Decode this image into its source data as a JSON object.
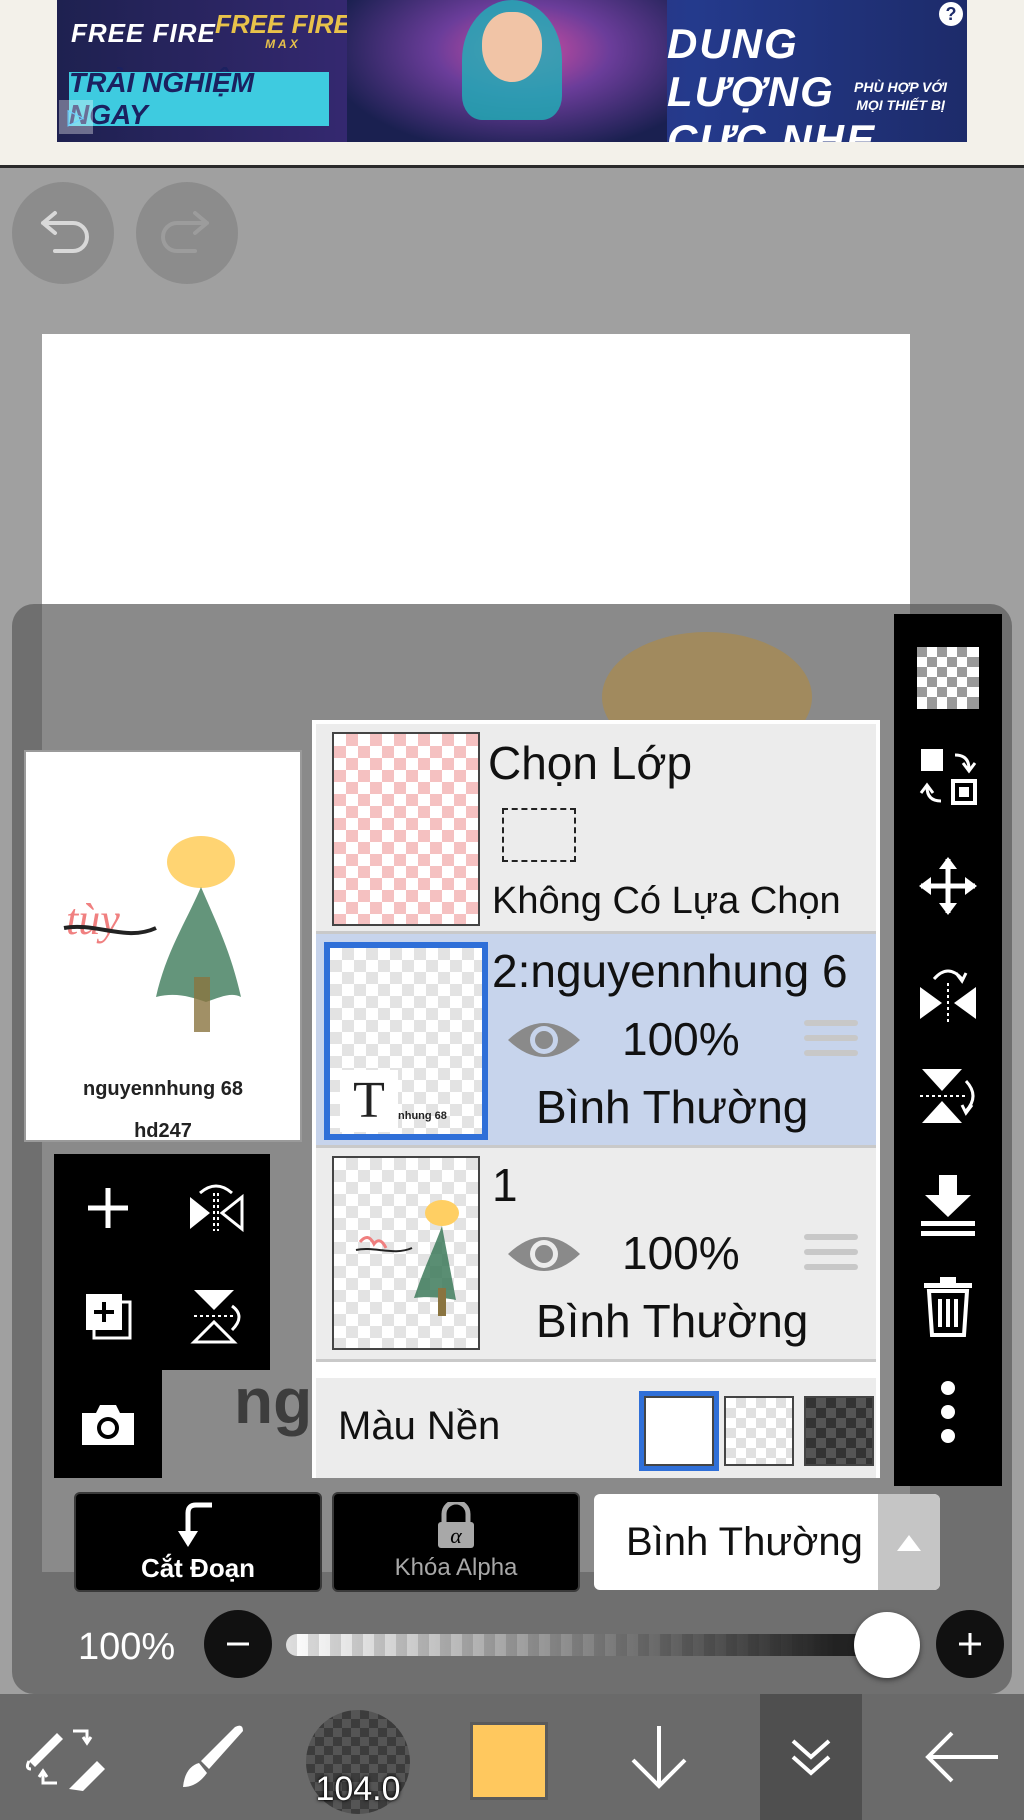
{
  "ad": {
    "brand1": "FREE FIRE",
    "brand2": "FREE FIRE",
    "brand2_sub": "MAX",
    "cta": "TRẢI NGHIỆM NGAY",
    "headline_line1": "DUNG LƯỢNG",
    "headline_line2": "CỰC NHẸ",
    "small_line1": "PHÙ HỢP VỚI",
    "small_line2": "MỌI THIẾT BỊ",
    "help": "?"
  },
  "preview": {
    "caption_line1": "nguyennhung 68",
    "caption_line2": "hd247",
    "doodle_text": "tùy"
  },
  "canvas": {
    "ghost_text": "ng"
  },
  "layers": {
    "selection": {
      "title": "Chọn Lớp",
      "status": "Không Có Lựa Chọn"
    },
    "items": [
      {
        "title": "2:nguyennhung 6",
        "opacity": "100%",
        "mode": "Bình Thường",
        "thumb_letter": "T",
        "thumb_text": "nhung 68",
        "selected": true
      },
      {
        "title": "1",
        "opacity": "100%",
        "mode": "Bình Thường",
        "selected": false
      }
    ],
    "background": {
      "label": "Màu Nền"
    }
  },
  "actions": {
    "clip_label": "Cắt Đoạn",
    "alpha_label": "Khóa Alpha",
    "alpha_glyph": "α",
    "blend_mode": "Bình Thường"
  },
  "opacity": {
    "label": "100%",
    "value": 1.0
  },
  "toolbar": {
    "brush_size": "104.0",
    "color": "#ffc85e"
  },
  "icons": [
    "undo-icon",
    "redo-icon",
    "checker-icon",
    "transform-icon",
    "move-icon",
    "flip-h-icon",
    "flip-v-icon",
    "merge-down-icon",
    "trash-icon",
    "more-icon",
    "add-layer-icon",
    "duplicate-icon",
    "camera-icon",
    "arrow-down-icon",
    "chevrons-down-icon",
    "back-arrow-icon"
  ]
}
